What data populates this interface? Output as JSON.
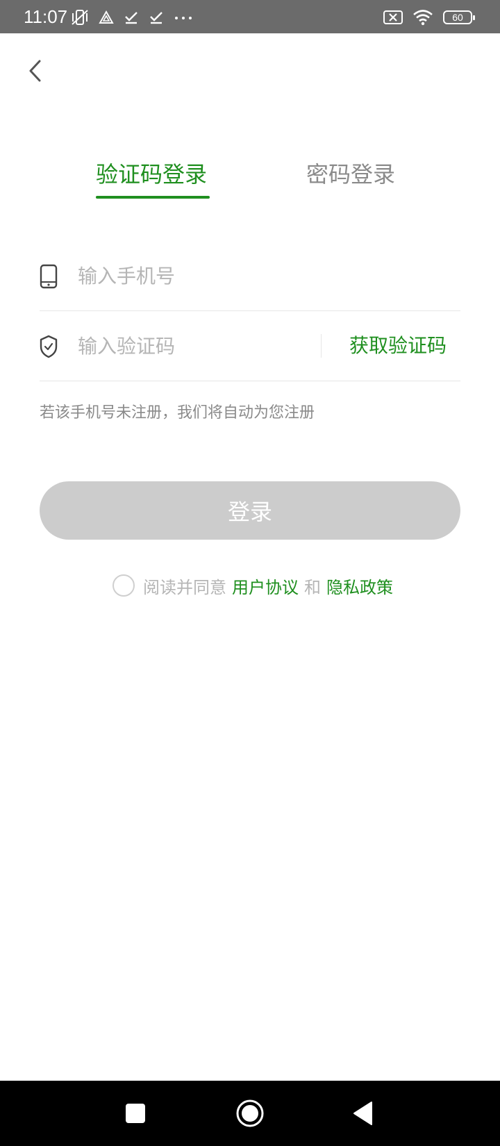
{
  "status_bar": {
    "time": "11:07",
    "battery": "60",
    "icons": [
      "mute-vibrate-icon",
      "triangle-icon",
      "check-icon",
      "check-icon",
      "more-dots-icon",
      "sim-off-icon",
      "wifi-icon",
      "battery-icon"
    ]
  },
  "tabs": {
    "active_label": "验证码登录",
    "inactive_label": "密码登录"
  },
  "phone_field": {
    "placeholder": "输入手机号",
    "value": ""
  },
  "code_field": {
    "placeholder": "输入验证码",
    "value": "",
    "get_code_label": "获取验证码"
  },
  "hint": "若该手机号未注册，我们将自动为您注册",
  "login_button": "登录",
  "agreement": {
    "prefix": "阅读并同意",
    "user_agreement": "用户协议",
    "and": "和",
    "privacy_policy": "隐私政策",
    "checked": false
  },
  "colors": {
    "accent": "#1f8f1f",
    "disabled_button": "#cccccc",
    "status_bar": "#6b6b6b"
  }
}
